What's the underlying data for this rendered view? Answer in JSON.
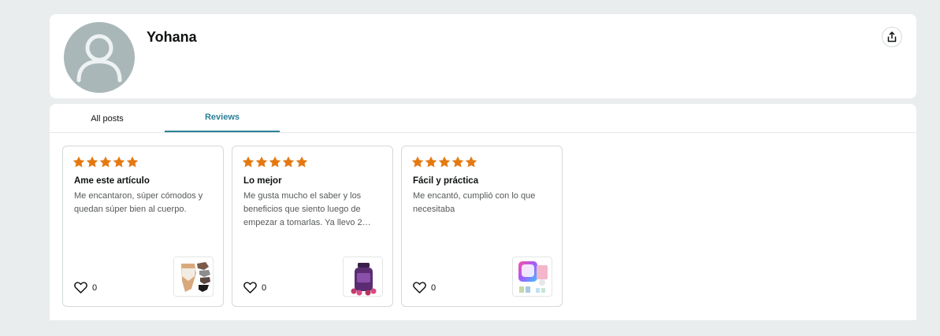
{
  "profile": {
    "name": "Yohana",
    "avatar_icon": "default-user-icon",
    "share_icon": "share-icon"
  },
  "tabs": [
    {
      "label": "All posts",
      "selected": false
    },
    {
      "label": "Reviews",
      "selected": true
    }
  ],
  "colors": {
    "accent_teal": "#2a8097",
    "star_orange": "#e47911",
    "page_bg": "#eaeded"
  },
  "reviews": [
    {
      "rating": 5,
      "title": "Ame este artículo",
      "text": "Me encantaron, súper cómodos y quedan súper bien al cuerpo.",
      "likes": "0",
      "product_image": "underwear-product-thumbnail"
    },
    {
      "rating": 5,
      "title": "Lo mejor",
      "text": "Me gusta mucho el saber y los beneficios que siento luego de empezar a tomarlas. Ya llevo 2…",
      "likes": "0",
      "product_image": "gummies-bottle-thumbnail"
    },
    {
      "rating": 5,
      "title": "Fácil y práctica",
      "text": "Me encantó, cumplió con lo que necesitaba",
      "likes": "0",
      "product_image": "colorful-app-box-thumbnail"
    }
  ]
}
